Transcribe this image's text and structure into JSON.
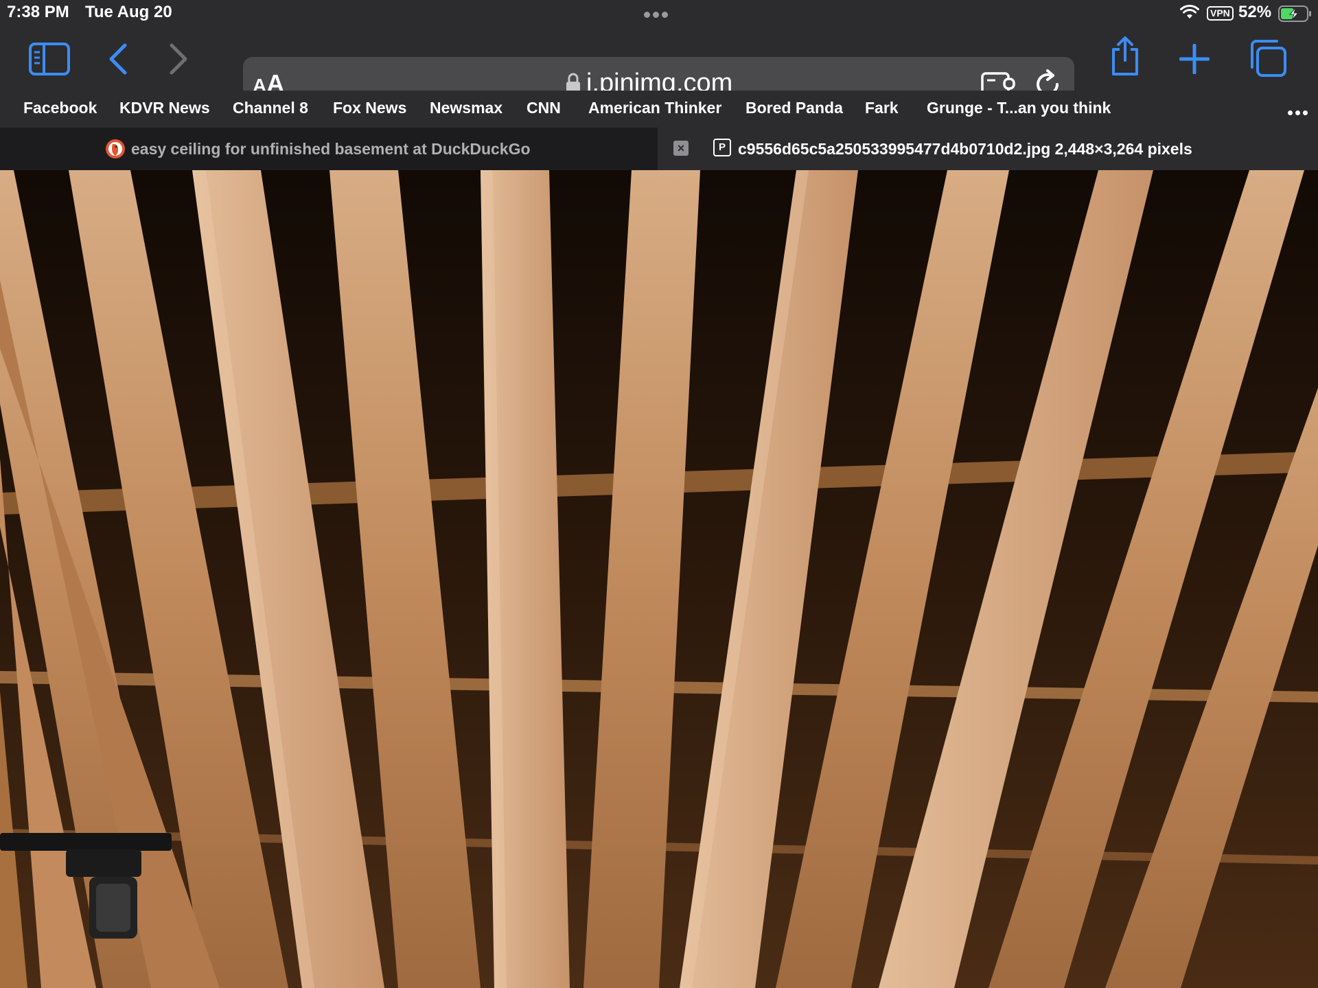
{
  "status_bar": {
    "time": "7:38 PM",
    "date": "Tue Aug 20",
    "vpn_label": "VPN",
    "battery_percent": "52%",
    "battery_level": 0.52
  },
  "toolbar": {
    "icons": [
      "sidebar-icon",
      "back-icon",
      "forward-icon",
      "share-icon",
      "new-tab-icon",
      "tabs-overview-icon"
    ],
    "accent_color": "#3b8df5"
  },
  "address_bar": {
    "reader_label_small": "A",
    "reader_label_large": "A",
    "url": "i.pinimg.com",
    "icons": [
      "lock-icon",
      "extensions-icon",
      "reload-icon"
    ]
  },
  "bookmarks": [
    "Facebook",
    "KDVR News",
    "Channel 8",
    "Fox News",
    "Newsmax",
    "CNN",
    "American Thinker",
    "Bored Panda",
    "Fark",
    "Grunge - T...an you think"
  ],
  "tabs": [
    {
      "title": "easy ceiling for unfinished basement at DuckDuckGo",
      "active": false
    },
    {
      "title": "c9556d65c5a250533995477d4b0710d2.jpg 2,448×3,264 pixels",
      "active": true
    }
  ],
  "content": {
    "image_subject": "wood slat ceiling photo"
  }
}
